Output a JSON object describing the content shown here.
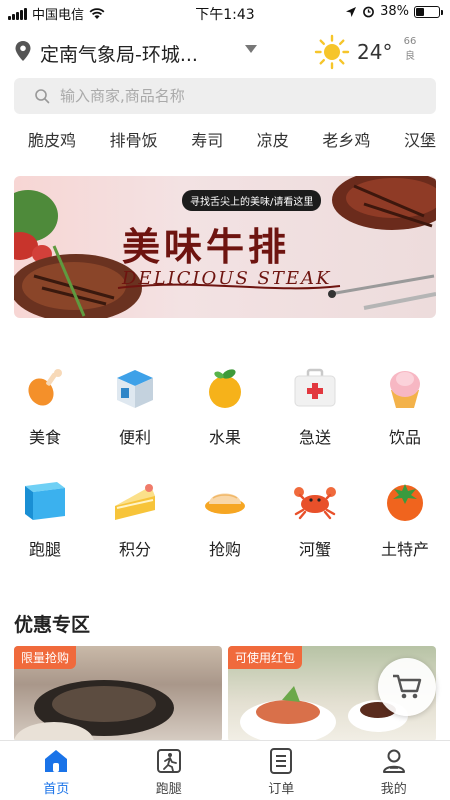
{
  "status_bar": {
    "carrier": "中国电信",
    "time": "下午1:43",
    "battery_percent_text": "38%",
    "battery_level": 0.38
  },
  "header": {
    "location": "定南气象局-环城...",
    "temperature": "24°",
    "aqi_value": "66",
    "aqi_level": "良"
  },
  "search": {
    "placeholder": "输入商家,商品名称"
  },
  "tags": [
    "脆皮鸡",
    "排骨饭",
    "寿司",
    "凉皮",
    "老乡鸡",
    "汉堡"
  ],
  "banner": {
    "subtitle": "寻找舌尖上的美味/请看这里",
    "title": "美味牛排",
    "title_en": "DELICIOUS STEAK"
  },
  "services": [
    {
      "label": "美食",
      "icon": "drumstick-icon"
    },
    {
      "label": "便利",
      "icon": "store-icon"
    },
    {
      "label": "水果",
      "icon": "orange-icon"
    },
    {
      "label": "急送",
      "icon": "first-aid-kit-icon"
    },
    {
      "label": "饮品",
      "icon": "cupcake-icon"
    },
    {
      "label": "跑腿",
      "icon": "box-icon"
    },
    {
      "label": "积分",
      "icon": "cake-icon"
    },
    {
      "label": "抢购",
      "icon": "bun-icon"
    },
    {
      "label": "河蟹",
      "icon": "crab-icon"
    },
    {
      "label": "土特产",
      "icon": "tomato-icon"
    }
  ],
  "promo": {
    "title": "优惠专区",
    "cards": [
      {
        "badge": "限量抢购"
      },
      {
        "badge": "可使用红包"
      }
    ]
  },
  "tabbar": {
    "tabs": [
      {
        "label": "首页",
        "icon": "home-icon",
        "active": true
      },
      {
        "label": "跑腿",
        "icon": "errand-icon",
        "active": false
      },
      {
        "label": "订单",
        "icon": "order-list-icon",
        "active": false
      },
      {
        "label": "我的",
        "icon": "profile-icon",
        "active": false
      }
    ]
  },
  "colors": {
    "accent": "#1a73e8",
    "badge": "#f06a3c",
    "banner_text": "#6e1410"
  }
}
